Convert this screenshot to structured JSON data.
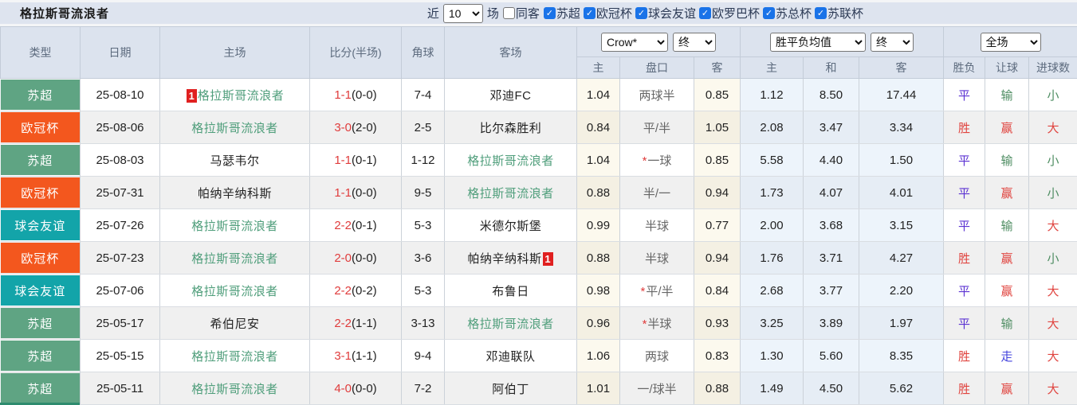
{
  "page": {
    "title": "格拉斯哥流浪者",
    "filters": {
      "recent_label": "近",
      "recent_value": "10",
      "unit_label": "场",
      "same_away": {
        "label": "同客",
        "checked": false
      },
      "leagues": [
        {
          "label": "苏超",
          "checked": true
        },
        {
          "label": "欧冠杯",
          "checked": true
        },
        {
          "label": "球会友谊",
          "checked": true
        },
        {
          "label": "欧罗巴杯",
          "checked": true
        },
        {
          "label": "苏总杯",
          "checked": true
        },
        {
          "label": "苏联杯",
          "checked": true
        }
      ]
    }
  },
  "table": {
    "controls": {
      "odds_source": "Crow*",
      "odds_source_final": "终",
      "wdl_mean": "胜平负均值",
      "wdl_mean_final": "终",
      "scope": "全场"
    },
    "headers": {
      "type": "类型",
      "date": "日期",
      "home": "主场",
      "score": "比分(半场)",
      "corner": "角球",
      "away": "客场",
      "sub_home": "主",
      "sub_handicap": "盘口",
      "sub_away": "客",
      "sub_win": "主",
      "sub_draw": "和",
      "sub_lose": "客",
      "sub_outcome": "胜负",
      "sub_handicap_result": "让球",
      "sub_goals": "进球数"
    },
    "rows": [
      {
        "type": "苏超",
        "date": "25-08-10",
        "home": {
          "name": "格拉斯哥流浪者",
          "subject": true,
          "red_card": "1"
        },
        "score": "1-1",
        "half_score": "(0-0)",
        "corners": "7-4",
        "away": {
          "name": "邓迪FC",
          "subject": false,
          "red_card": ""
        },
        "crow": {
          "home": "1.04",
          "star": false,
          "handicap": "两球半",
          "away": "0.85"
        },
        "wdl_mean": {
          "win": "1.12",
          "draw": "8.50",
          "lose": "17.44"
        },
        "results": {
          "outcome": {
            "text": "平",
            "c": "blue"
          },
          "handicap": {
            "text": "输",
            "c": "green"
          },
          "goals": {
            "text": "小",
            "c": "green"
          }
        }
      },
      {
        "type": "欧冠杯",
        "date": "25-08-06",
        "home": {
          "name": "格拉斯哥流浪者",
          "subject": true,
          "red_card": ""
        },
        "score": "3-0",
        "half_score": "(2-0)",
        "corners": "2-5",
        "away": {
          "name": "比尔森胜利",
          "subject": false,
          "red_card": ""
        },
        "crow": {
          "home": "0.84",
          "star": false,
          "handicap": "平/半",
          "away": "1.05"
        },
        "wdl_mean": {
          "win": "2.08",
          "draw": "3.47",
          "lose": "3.34"
        },
        "results": {
          "outcome": {
            "text": "胜",
            "c": "red"
          },
          "handicap": {
            "text": "赢",
            "c": "red"
          },
          "goals": {
            "text": "大",
            "c": "red"
          }
        }
      },
      {
        "type": "苏超",
        "date": "25-08-03",
        "home": {
          "name": "马瑟韦尔",
          "subject": false,
          "red_card": ""
        },
        "score": "1-1",
        "half_score": "(0-1)",
        "corners": "1-12",
        "away": {
          "name": "格拉斯哥流浪者",
          "subject": true,
          "red_card": ""
        },
        "crow": {
          "home": "1.04",
          "star": true,
          "handicap": "一球",
          "away": "0.85"
        },
        "wdl_mean": {
          "win": "5.58",
          "draw": "4.40",
          "lose": "1.50"
        },
        "results": {
          "outcome": {
            "text": "平",
            "c": "blue"
          },
          "handicap": {
            "text": "输",
            "c": "green"
          },
          "goals": {
            "text": "小",
            "c": "green"
          }
        }
      },
      {
        "type": "欧冠杯",
        "date": "25-07-31",
        "home": {
          "name": "帕纳辛纳科斯",
          "subject": false,
          "red_card": ""
        },
        "score": "1-1",
        "half_score": "(0-0)",
        "corners": "9-5",
        "away": {
          "name": "格拉斯哥流浪者",
          "subject": true,
          "red_card": ""
        },
        "crow": {
          "home": "0.88",
          "star": false,
          "handicap": "半/一",
          "away": "0.94"
        },
        "wdl_mean": {
          "win": "1.73",
          "draw": "4.07",
          "lose": "4.01"
        },
        "results": {
          "outcome": {
            "text": "平",
            "c": "blue"
          },
          "handicap": {
            "text": "赢",
            "c": "red"
          },
          "goals": {
            "text": "小",
            "c": "green"
          }
        }
      },
      {
        "type": "球会友谊",
        "date": "25-07-26",
        "home": {
          "name": "格拉斯哥流浪者",
          "subject": true,
          "red_card": ""
        },
        "score": "2-2",
        "half_score": "(0-1)",
        "corners": "5-3",
        "away": {
          "name": "米德尔斯堡",
          "subject": false,
          "red_card": ""
        },
        "crow": {
          "home": "0.99",
          "star": false,
          "handicap": "半球",
          "away": "0.77"
        },
        "wdl_mean": {
          "win": "2.00",
          "draw": "3.68",
          "lose": "3.15"
        },
        "results": {
          "outcome": {
            "text": "平",
            "c": "blue"
          },
          "handicap": {
            "text": "输",
            "c": "green"
          },
          "goals": {
            "text": "大",
            "c": "red"
          }
        }
      },
      {
        "type": "欧冠杯",
        "date": "25-07-23",
        "home": {
          "name": "格拉斯哥流浪者",
          "subject": true,
          "red_card": ""
        },
        "score": "2-0",
        "half_score": "(0-0)",
        "corners": "3-6",
        "away": {
          "name": "帕纳辛纳科斯",
          "subject": false,
          "red_card": "1"
        },
        "crow": {
          "home": "0.88",
          "star": false,
          "handicap": "半球",
          "away": "0.94"
        },
        "wdl_mean": {
          "win": "1.76",
          "draw": "3.71",
          "lose": "4.27"
        },
        "results": {
          "outcome": {
            "text": "胜",
            "c": "red"
          },
          "handicap": {
            "text": "赢",
            "c": "red"
          },
          "goals": {
            "text": "小",
            "c": "green"
          }
        }
      },
      {
        "type": "球会友谊",
        "date": "25-07-06",
        "home": {
          "name": "格拉斯哥流浪者",
          "subject": true,
          "red_card": ""
        },
        "score": "2-2",
        "half_score": "(0-2)",
        "corners": "5-3",
        "away": {
          "name": "布鲁日",
          "subject": false,
          "red_card": ""
        },
        "crow": {
          "home": "0.98",
          "star": true,
          "handicap": "平/半",
          "away": "0.84"
        },
        "wdl_mean": {
          "win": "2.68",
          "draw": "3.77",
          "lose": "2.20"
        },
        "results": {
          "outcome": {
            "text": "平",
            "c": "blue"
          },
          "handicap": {
            "text": "赢",
            "c": "red"
          },
          "goals": {
            "text": "大",
            "c": "red"
          }
        }
      },
      {
        "type": "苏超",
        "date": "25-05-17",
        "home": {
          "name": "希伯尼安",
          "subject": false,
          "red_card": ""
        },
        "score": "2-2",
        "half_score": "(1-1)",
        "corners": "3-13",
        "away": {
          "name": "格拉斯哥流浪者",
          "subject": true,
          "red_card": ""
        },
        "crow": {
          "home": "0.96",
          "star": true,
          "handicap": "半球",
          "away": "0.93"
        },
        "wdl_mean": {
          "win": "3.25",
          "draw": "3.89",
          "lose": "1.97"
        },
        "results": {
          "outcome": {
            "text": "平",
            "c": "blue"
          },
          "handicap": {
            "text": "输",
            "c": "green"
          },
          "goals": {
            "text": "大",
            "c": "red"
          }
        }
      },
      {
        "type": "苏超",
        "date": "25-05-15",
        "home": {
          "name": "格拉斯哥流浪者",
          "subject": true,
          "red_card": ""
        },
        "score": "3-1",
        "half_score": "(1-1)",
        "corners": "9-4",
        "away": {
          "name": "邓迪联队",
          "subject": false,
          "red_card": ""
        },
        "crow": {
          "home": "1.06",
          "star": false,
          "handicap": "两球",
          "away": "0.83"
        },
        "wdl_mean": {
          "win": "1.30",
          "draw": "5.60",
          "lose": "8.35"
        },
        "results": {
          "outcome": {
            "text": "胜",
            "c": "red"
          },
          "handicap": {
            "text": "走",
            "c": "walk_blue"
          },
          "goals": {
            "text": "大",
            "c": "red"
          }
        }
      },
      {
        "type": "苏超",
        "date": "25-05-11",
        "home": {
          "name": "格拉斯哥流浪者",
          "subject": true,
          "red_card": ""
        },
        "score": "4-0",
        "half_score": "(0-0)",
        "corners": "7-2",
        "away": {
          "name": "阿伯丁",
          "subject": false,
          "red_card": ""
        },
        "crow": {
          "home": "1.01",
          "star": false,
          "handicap": "一/球半",
          "away": "0.88"
        },
        "wdl_mean": {
          "win": "1.49",
          "draw": "4.50",
          "lose": "5.62"
        },
        "results": {
          "outcome": {
            "text": "胜",
            "c": "red"
          },
          "handicap": {
            "text": "赢",
            "c": "red"
          },
          "goals": {
            "text": "大",
            "c": "red"
          }
        }
      }
    ]
  },
  "colors": {
    "type_badges": {
      "苏超": "#5fa483",
      "欧冠杯": "#f3571e",
      "球会友谊": "#13a4a9"
    },
    "subject_team": "#4f9e7b",
    "score_red": "#e03c3c",
    "card_badge": "#e02020",
    "handicap_star": "#e03c3c",
    "results": {
      "red": "#e0443f",
      "blue": "#5b32d2",
      "green": "#4e8d62",
      "walk_blue": "#4444dd"
    }
  }
}
